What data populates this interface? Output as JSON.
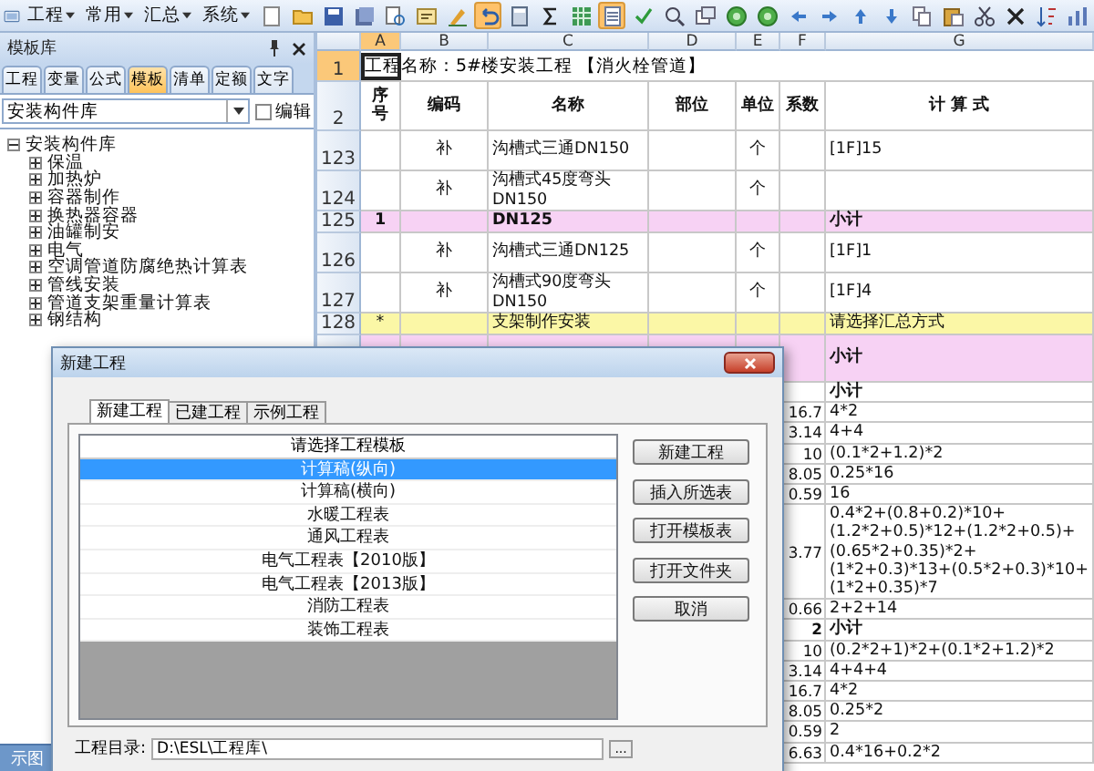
{
  "menus": [
    {
      "label": "工程"
    },
    {
      "label": "常用"
    },
    {
      "label": "汇总"
    },
    {
      "label": "系统"
    }
  ],
  "toolbar": [
    {
      "kind": "page",
      "active": false
    },
    {
      "kind": "folder",
      "active": false
    },
    {
      "kind": "save",
      "active": false
    },
    {
      "kind": "saveall",
      "active": false
    },
    {
      "kind": "preview",
      "active": false
    },
    {
      "kind": "props",
      "active": false
    },
    {
      "kind": "edit",
      "active": false
    },
    {
      "kind": "undo",
      "active": true
    },
    {
      "kind": "calc",
      "active": false
    },
    {
      "kind": "sum",
      "active": false
    },
    {
      "kind": "grid",
      "active": false
    },
    {
      "kind": "layout",
      "active": true
    },
    {
      "kind": "check",
      "active": false
    },
    {
      "kind": "zoom",
      "active": false
    },
    {
      "kind": "window",
      "active": false
    },
    {
      "kind": "green",
      "active": false
    },
    {
      "kind": "green",
      "active": false
    },
    {
      "kind": "left",
      "active": false
    },
    {
      "kind": "right",
      "active": false
    },
    {
      "kind": "up",
      "active": false
    },
    {
      "kind": "down",
      "active": false
    },
    {
      "kind": "copy",
      "active": false
    },
    {
      "kind": "paste",
      "active": false
    },
    {
      "kind": "cut",
      "active": false
    },
    {
      "kind": "delete",
      "active": false
    },
    {
      "kind": "sort",
      "active": false
    },
    {
      "kind": "chart",
      "active": false
    }
  ],
  "left_panel": {
    "title": "模板库",
    "tabs": [
      {
        "label": "工程",
        "selected": false
      },
      {
        "label": "变量",
        "selected": false
      },
      {
        "label": "公式",
        "selected": false
      },
      {
        "label": "模板",
        "selected": true
      },
      {
        "label": "清单",
        "selected": false
      },
      {
        "label": "定额",
        "selected": false
      },
      {
        "label": "文字",
        "selected": false
      }
    ],
    "library_select": "安装构件库",
    "edit_checkbox": {
      "label": "编辑",
      "checked": false
    },
    "tree": {
      "label": "安装构件库",
      "expanded": true,
      "children": [
        {
          "label": "保温",
          "expanded": false
        },
        {
          "label": "加热炉",
          "expanded": false
        },
        {
          "label": "容器制作",
          "expanded": false
        },
        {
          "label": "换热器容器",
          "expanded": false
        },
        {
          "label": "油罐制安",
          "expanded": false
        },
        {
          "label": "电气",
          "expanded": false
        },
        {
          "label": "空调管道防腐绝热计算表",
          "expanded": false
        },
        {
          "label": "管线安装",
          "expanded": false
        },
        {
          "label": "管道支架重量计算表",
          "expanded": false
        },
        {
          "label": "钢结构",
          "expanded": false
        }
      ]
    },
    "bottom_tab": "示图"
  },
  "sheet": {
    "columns": [
      {
        "label": "A",
        "selected": true
      },
      {
        "label": "B",
        "selected": false
      },
      {
        "label": "C",
        "selected": false
      },
      {
        "label": "D",
        "selected": false
      },
      {
        "label": "E",
        "selected": false
      },
      {
        "label": "F",
        "selected": false
      },
      {
        "label": "G",
        "selected": false
      }
    ],
    "title_row": {
      "number": "1",
      "text": "工程名称：5#楼安装工程 【消火栓管道】",
      "selected": true
    },
    "header_row": {
      "number": "2",
      "cells": [
        "序号",
        "编码",
        "名称",
        "部位",
        "单位",
        "系数",
        "计 算 式"
      ]
    },
    "rows": [
      {
        "number": "123",
        "kind": "item",
        "b": "补",
        "c": "沟槽式三通DN150",
        "e": "个",
        "g": "[1F]15"
      },
      {
        "number": "124",
        "kind": "item",
        "b": "补",
        "c": "沟槽式45度弯头DN150",
        "e": "个"
      },
      {
        "number": "125",
        "kind": "subtotal",
        "a": "1",
        "c": "DN125",
        "g": "小计"
      },
      {
        "number": "126",
        "kind": "item",
        "b": "补",
        "c": "沟槽式三通DN125",
        "e": "个",
        "g": "[1F]1"
      },
      {
        "number": "127",
        "kind": "item",
        "b": "补",
        "c": "沟槽式90度弯头DN150",
        "e": "个",
        "g": "[1F]4"
      },
      {
        "number": "128",
        "kind": "group",
        "a": "*",
        "c": "支架制作安装",
        "g": "请选择汇总方式"
      },
      {
        "kind": "section",
        "g": "小计"
      },
      {
        "kind": "heading",
        "g": "小计"
      },
      {
        "kind": "line",
        "f": "16.7",
        "g": "4*2"
      },
      {
        "kind": "line",
        "f": "3.14",
        "g": "4+4"
      },
      {
        "kind": "line",
        "f": "10",
        "g": "(0.1*2+1.2)*2"
      },
      {
        "kind": "line",
        "f": "8.05",
        "g": "0.25*16"
      },
      {
        "kind": "line",
        "f": "0.59",
        "g": "16"
      },
      {
        "kind": "line",
        "f": "3.77",
        "g": "0.4*2+(0.8+0.2)*10+(1.2*2+0.5)*12+(1.2*2+0.5)+(0.65*2+0.35)*2+(1*2+0.3)*13+(0.5*2+0.3)*10+(1*2+0.35)*7"
      },
      {
        "kind": "line",
        "f": "0.66",
        "g": "2+2+14"
      },
      {
        "kind": "heading",
        "f": "2",
        "g": "小计"
      },
      {
        "kind": "line",
        "f": "10",
        "g": "(0.2*2+1)*2+(0.1*2+1.2)*2"
      },
      {
        "kind": "line",
        "f": "3.14",
        "g": "4+4+4"
      },
      {
        "kind": "line",
        "f": "16.7",
        "g": "4*2"
      },
      {
        "kind": "line",
        "f": "8.05",
        "g": "0.25*2"
      },
      {
        "kind": "line",
        "f": "0.59",
        "g": "2"
      },
      {
        "kind": "line",
        "f": "6.63",
        "g": "0.4*16+0.2*2"
      }
    ]
  },
  "dialog": {
    "title": "新建工程",
    "tabs": [
      {
        "label": "新建工程",
        "selected": true
      },
      {
        "label": "已建工程",
        "selected": false
      },
      {
        "label": "示例工程",
        "selected": false
      }
    ],
    "list_header": "请选择工程模板",
    "templates": [
      {
        "label": "计算稿(纵向)",
        "selected": true
      },
      {
        "label": "计算稿(横向)",
        "selected": false
      },
      {
        "label": "水暖工程表",
        "selected": false
      },
      {
        "label": "通风工程表",
        "selected": false
      },
      {
        "label": "电气工程表【2010版】",
        "selected": false
      },
      {
        "label": "电气工程表【2013版】",
        "selected": false
      },
      {
        "label": "消防工程表",
        "selected": false
      },
      {
        "label": "装饰工程表",
        "selected": false
      }
    ],
    "buttons": [
      "新建工程",
      "插入所选表",
      "打开模板表",
      "打开文件夹",
      "取消"
    ],
    "directory": {
      "label": "工程目录:",
      "value": "D:\\ESL\\工程库\\",
      "browse": "..."
    }
  }
}
